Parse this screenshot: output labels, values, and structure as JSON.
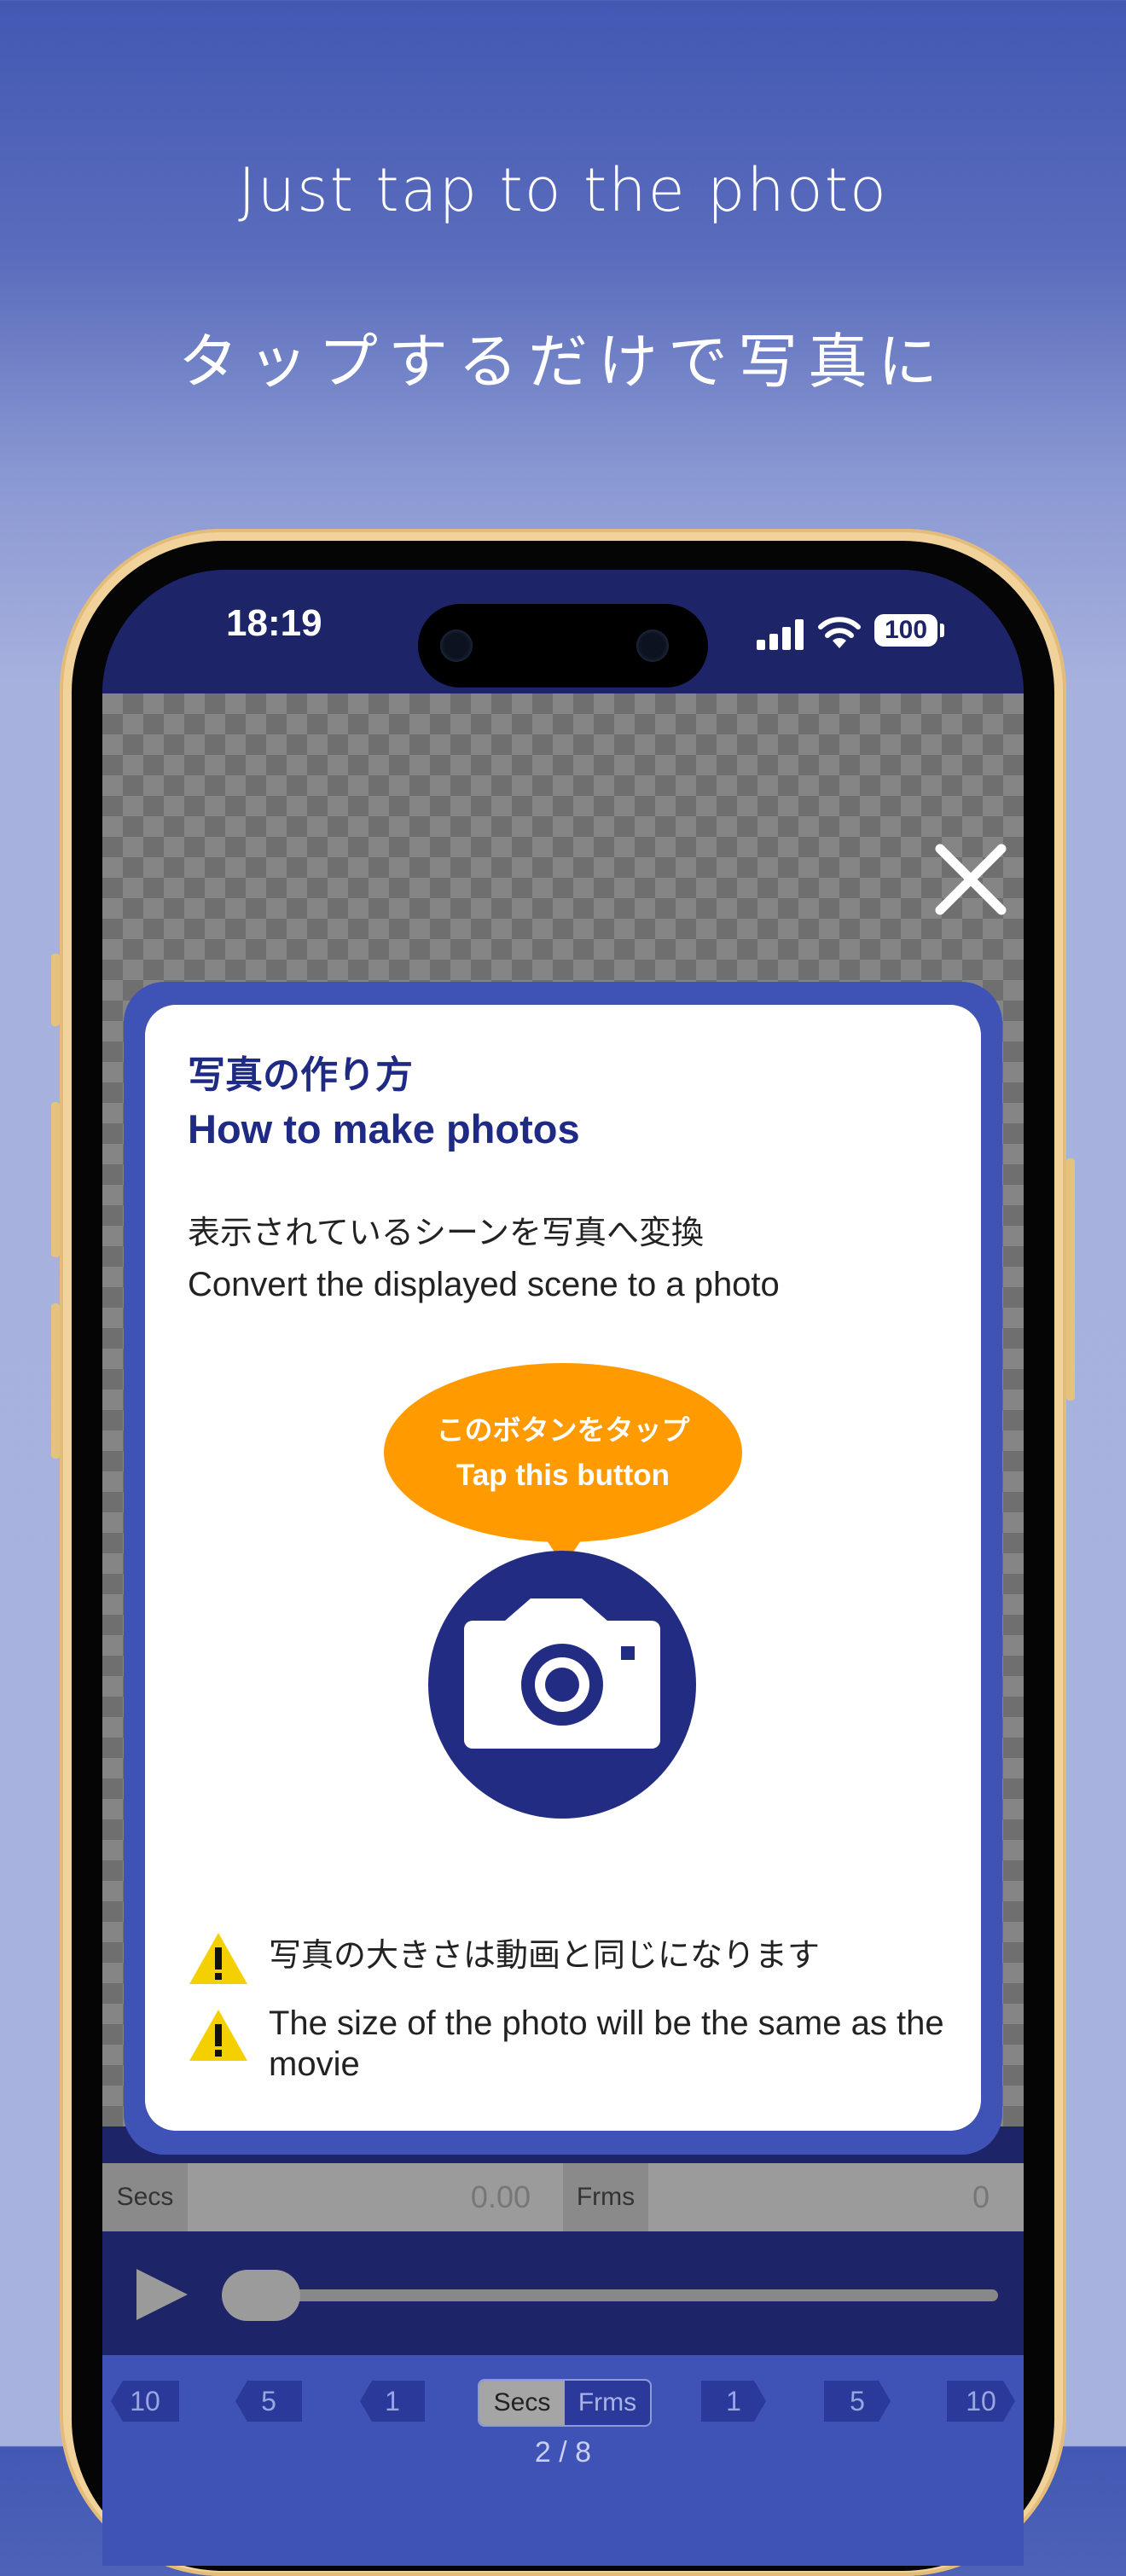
{
  "headline": {
    "english": "Just tap to the photo",
    "japanese": "タップするだけで写真に"
  },
  "status_bar": {
    "time": "18:19",
    "battery": "100"
  },
  "modal": {
    "title_jp": "写真の作り方",
    "title_en": "How to make photos",
    "desc_jp": "表示されているシーンを写真へ変換",
    "desc_en": "Convert the displayed scene to a photo",
    "bubble_jp": "このボタンをタップ",
    "bubble_en": "Tap this button",
    "warning_jp": "写真の大きさは動画と同じになります",
    "warning_en": "The size of the photo will be the same as the movie"
  },
  "timebar": {
    "secs_label": "Secs",
    "secs_value": "0.00",
    "frms_label": "Frms",
    "frms_value": "0"
  },
  "steps": {
    "back": [
      "10",
      "5",
      "1"
    ],
    "forward": [
      "1",
      "5",
      "10"
    ],
    "seg_secs": "Secs",
    "seg_frms": "Frms",
    "page": "2 / 8"
  },
  "colors": {
    "accent": "#3f52b5",
    "navy": "#1d2468",
    "bubble": "#ff9a00",
    "warning": "#f5d000"
  }
}
